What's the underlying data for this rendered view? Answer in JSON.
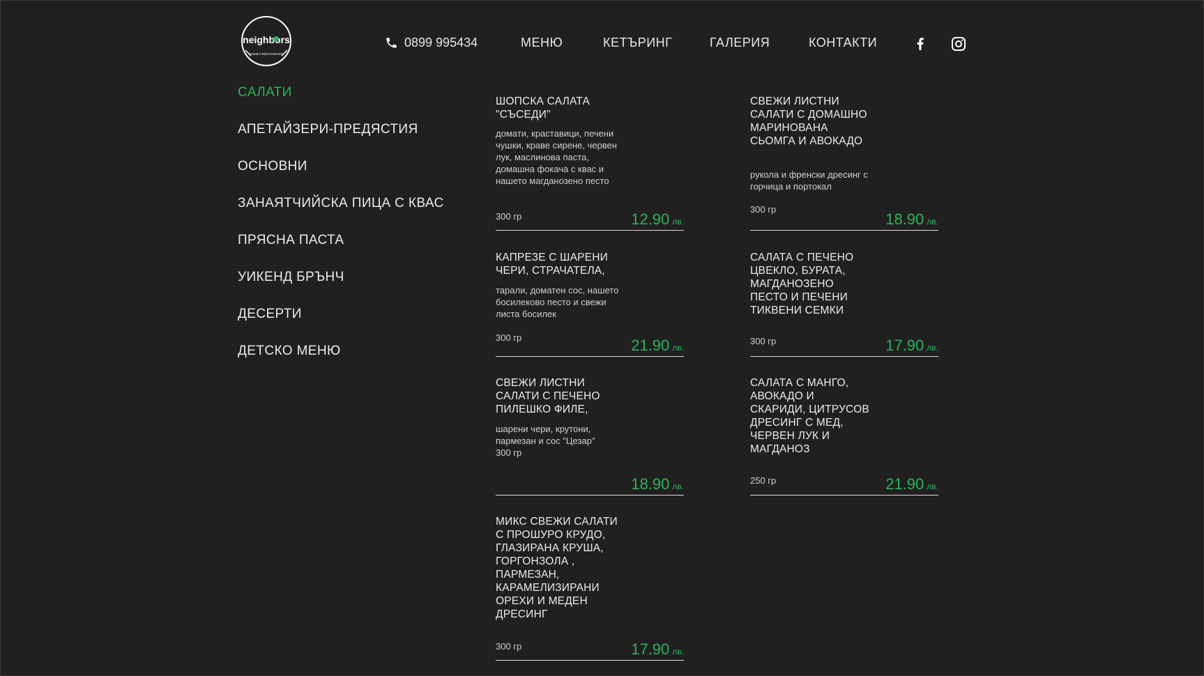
{
  "header": {
    "logo_text": "neighbors",
    "logo_subtext": "FAMILY RESTAURANT",
    "phone": "0899 995434",
    "nav": [
      "МЕНЮ",
      "КЕТЪРИНГ",
      "ГАЛЕРИЯ",
      "КОНТАКТИ"
    ],
    "social": [
      "facebook-icon",
      "instagram-icon"
    ]
  },
  "categories": [
    {
      "label": "САЛАТИ",
      "active": true
    },
    {
      "label": "АПЕТАЙЗЕРИ-ПРЕДЯСТИЯ",
      "active": false
    },
    {
      "label": "ОСНОВНИ",
      "active": false
    },
    {
      "label": "ЗАНАЯТЧИЙСКА ПИЦА С КВАС",
      "active": false
    },
    {
      "label": "ПРЯСНА ПАСТА",
      "active": false
    },
    {
      "label": "УИКЕНД БРЪНЧ",
      "active": false
    },
    {
      "label": "ДЕСЕРТИ",
      "active": false
    },
    {
      "label": "ДЕТСКО МЕНЮ",
      "active": false
    }
  ],
  "items": [
    {
      "title": "ШОПСКА САЛАТА \"СЪСЕДИ\"",
      "description": "домати, краставици, печени чушки, краве сирене, червен лук, маслинова паста, домашна фокача с квас и нашето магданозено песто",
      "weight": "300 гр",
      "price": "12.90",
      "currency": "лв."
    },
    {
      "title": "СВЕЖИ ЛИСТНИ САЛАТИ С ДОМАШНО МАРИНОВАНА СЬОМГА И АВОКАДО",
      "description": "рукола и френски дресинг с горчица и портокал",
      "weight": "300 гр",
      "price": "18.90",
      "currency": "лв."
    },
    {
      "title": "КАПРЕЗЕ С ШАРЕНИ ЧЕРИ, СТРАЧАТЕЛА,",
      "description": "тарали, доматен сос, нашето босилеково песто и свежи листа босилек",
      "weight": "300 гр",
      "price": "21.90",
      "currency": "лв."
    },
    {
      "title": "САЛАТА С ПЕЧЕНО ЦВЕКЛО, БУРАТА, МАГДАНОЗЕНО ПЕСТО И ПЕЧЕНИ ТИКВЕНИ СЕМКИ",
      "description": "",
      "weight": "300 гр",
      "price": "17.90",
      "currency": "лв."
    },
    {
      "title": "СВЕЖИ ЛИСТНИ САЛАТИ С ПЕЧЕНО ПИЛЕШКО ФИЛЕ,",
      "description": "шарени чери, крутони, пармезан и сос \"Цезар\"",
      "weight": "300 гр",
      "price": "18.90",
      "currency": "лв."
    },
    {
      "title": "САЛАТА С МАНГО, АВОКАДО И СКАРИДИ, ЦИТРУСОВ ДРЕСИНГ С МЕД, ЧЕРВЕН ЛУК И МАГДАНОЗ",
      "description": "",
      "weight": "250 гр",
      "price": "21.90",
      "currency": "лв."
    },
    {
      "title": "МИКС СВЕЖИ САЛАТИ С ПРОШУРО КРУДО, ГЛАЗИРАНА КРУША, ГОРГОНЗОЛА , ПАРМЕЗАН, КАРАМЕЛИЗИРАНИ ОРЕХИ И МЕДЕН ДРЕСИНГ",
      "description": "",
      "weight": "300 гр",
      "price": "17.90",
      "currency": "лв."
    }
  ],
  "colors": {
    "background": "#202020",
    "accent": "#2fb35b",
    "text": "#ececec"
  }
}
